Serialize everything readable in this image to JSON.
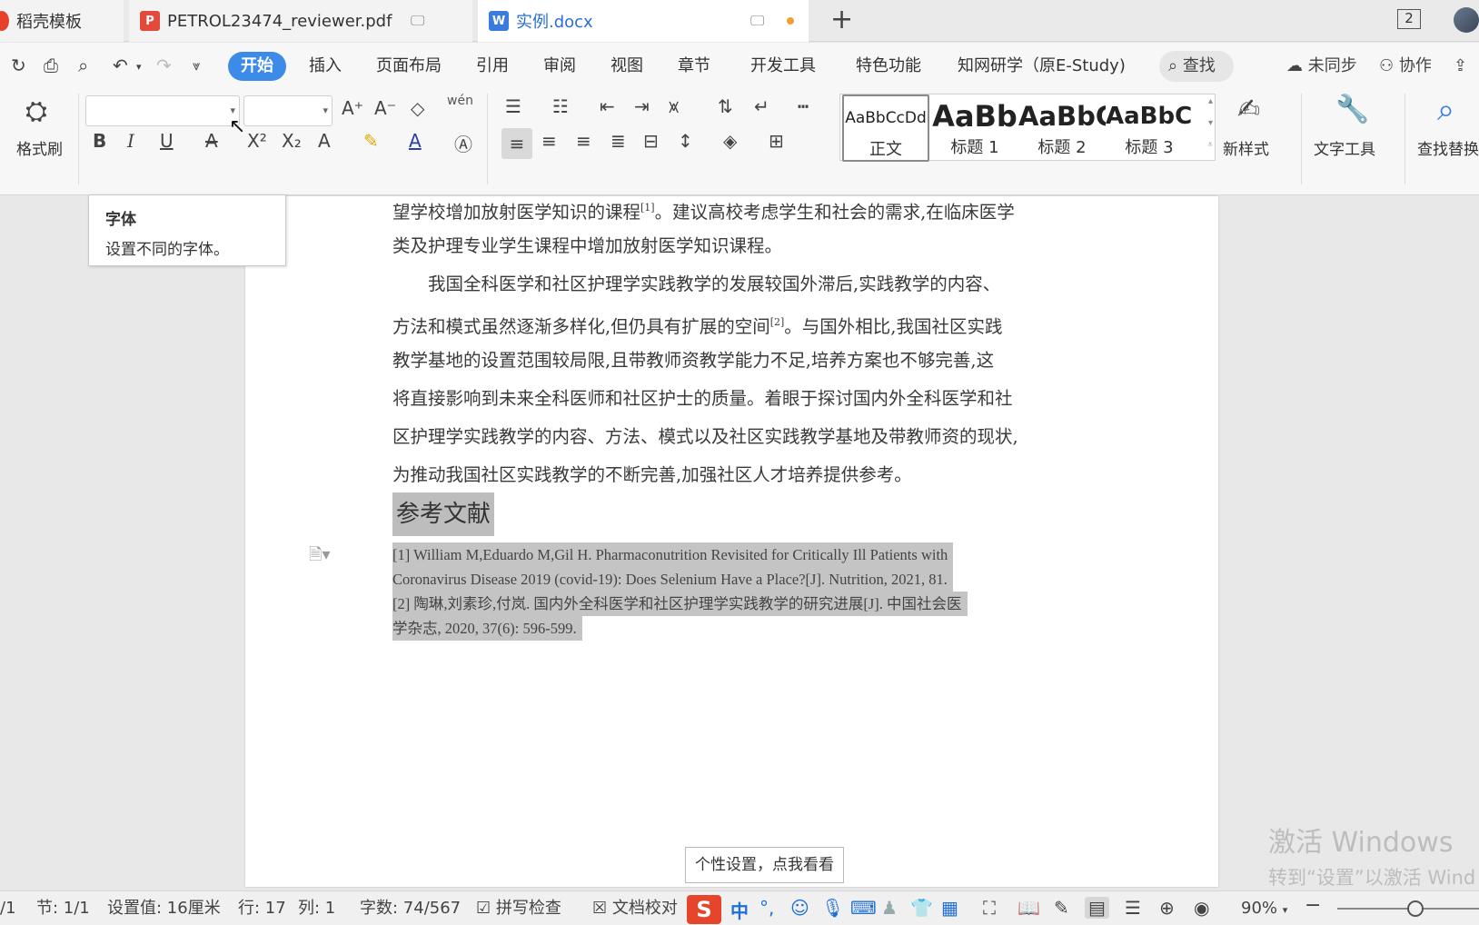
{
  "tabs": [
    {
      "label": "稻壳模板"
    },
    {
      "label": "PETROL23474_reviewer.pdf"
    },
    {
      "label": "实例.docx"
    }
  ],
  "window": {
    "count": "2"
  },
  "menu": {
    "start": "开始",
    "insert": "插入",
    "layout": "页面布局",
    "references": "引用",
    "review": "审阅",
    "view": "视图",
    "chapter": "章节",
    "developer": "开发工具",
    "special": "特色功能",
    "cnki": "知网研学（原E-Study)",
    "search": "查找",
    "sync": "未同步",
    "collab": "协作"
  },
  "ribbon": {
    "format_painter": "格式刷",
    "font_name": "",
    "font_size": "",
    "pinyin_glyph": "wén",
    "styles": [
      {
        "sample": "AaBbCcDd",
        "name": "正文"
      },
      {
        "sample": "AaBb",
        "name": "标题 1"
      },
      {
        "sample": "AaBbC",
        "name": "标题 2"
      },
      {
        "sample": "AaBbCc",
        "name": "标题 3"
      }
    ],
    "new_style": "新样式",
    "text_tools": "文字工具",
    "find_replace": "查找替换"
  },
  "tooltip": {
    "title": "字体",
    "desc": "设置不同的字体。"
  },
  "document": {
    "lines": [
      {
        "pre": "望学校增加放射医学知识的课程",
        "sup": "[1]",
        "post": "。建议高校考虑学生和社会的需求,在临床医学"
      },
      {
        "pre": "类及护理专业学生课程中增加放射医学知识课程。",
        "sup": "",
        "post": ""
      },
      {
        "pre": "　　我国全科医学和社区护理学实践教学的发展较国外滞后,实践教学的内容、",
        "sup": "",
        "post": ""
      },
      {
        "pre": "方法和模式虽然逐渐多样化,但仍具有扩展的空间",
        "sup": "[2]",
        "post": "。与国外相比,我国社区实践"
      },
      {
        "pre": "教学基地的设置范围较局限,且带教师资教学能力不足,培养方案也不够完善,这",
        "sup": "",
        "post": ""
      },
      {
        "pre": "将直接影响到未来全科医师和社区护士的质量。着眼于探讨国内外全科医学和社",
        "sup": "",
        "post": ""
      },
      {
        "pre": "区护理学实践教学的内容、方法、模式以及社区实践教学基地及带教师资的现状,",
        "sup": "",
        "post": ""
      },
      {
        "pre": "为推动我国社区实践教学的不断完善,加强社区人才培养提供参考。",
        "sup": "",
        "post": ""
      }
    ],
    "ref_heading": "参考文献",
    "references": [
      "[1] William M,Eduardo M,Gil H. Pharmaconutrition Revisited for Critically Ill Patients with",
      "Coronavirus Disease 2019 (covid-19): Does Selenium Have a Place?[J]. Nutrition, 2021, 81.",
      "[2]  陶琳,刘素珍,付岚. 国内外全科医学和社区护理学实践教学的研究进展[J]. 中国社会医",
      "学杂志, 2020, 37(6): 596-599."
    ]
  },
  "watermark": {
    "line1": "激活 Windows",
    "line2": "转到“设置”以激活 Wind"
  },
  "ime_tip": "个性设置，点我看看",
  "status": {
    "page": "/1",
    "section": "节: 1/1",
    "setting": "设置值: 16厘米",
    "row": "行: 17",
    "col": "列: 1",
    "wordcount": "字数: 74/567",
    "spellcheck": "拼写检查",
    "proofread": "文档校对",
    "ime_zh": "中",
    "ime_punct": "°,",
    "zoom": "90%",
    "zoom_fraction": 0.55
  },
  "colors": {
    "accent": "#3c8be8",
    "selection": "#c4c4c4",
    "ime": "#e5452a"
  }
}
